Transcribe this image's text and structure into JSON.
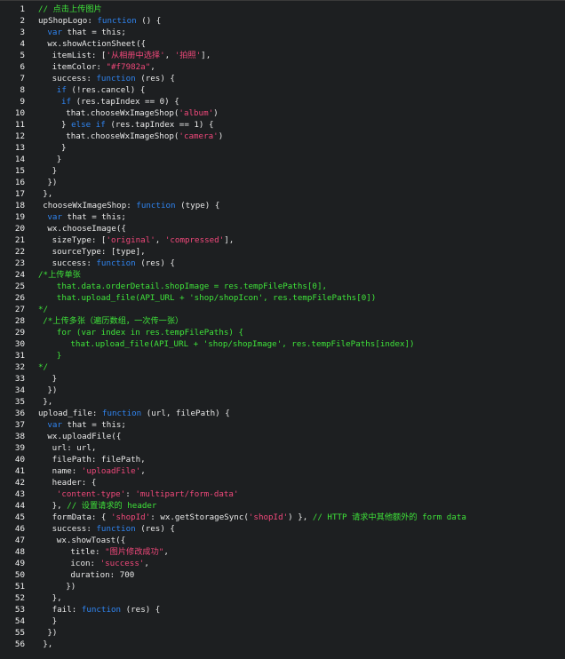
{
  "colors": {
    "background": "#1d1f21",
    "text": "#e8e8e8",
    "keyword": "#2f84f0",
    "string": "#f0487a",
    "comment": "#3fe43a",
    "line_number": "#f2f2f2"
  },
  "lines": [
    {
      "n": "1",
      "indent": 0,
      "tokens": [
        {
          "t": "// 点击上传图片",
          "c": "cm"
        }
      ]
    },
    {
      "n": "2",
      "indent": 0,
      "tokens": [
        {
          "t": "upShopLogo: "
        },
        {
          "t": "function",
          "c": "kw"
        },
        {
          "t": " () {"
        }
      ]
    },
    {
      "n": "3",
      "indent": 2,
      "tokens": [
        {
          "t": "var",
          "c": "kw"
        },
        {
          "t": " that = this;"
        }
      ]
    },
    {
      "n": "4",
      "indent": 2,
      "tokens": [
        {
          "t": "wx.showActionSheet({"
        }
      ]
    },
    {
      "n": "5",
      "indent": 3,
      "tokens": [
        {
          "t": "itemList: ["
        },
        {
          "t": "'从相册中选择'",
          "c": "str"
        },
        {
          "t": ", "
        },
        {
          "t": "'拍照'",
          "c": "str"
        },
        {
          "t": "],"
        }
      ]
    },
    {
      "n": "6",
      "indent": 3,
      "tokens": [
        {
          "t": "itemColor: "
        },
        {
          "t": "\"#f7982a\"",
          "c": "str"
        },
        {
          "t": ","
        }
      ]
    },
    {
      "n": "7",
      "indent": 3,
      "tokens": [
        {
          "t": "success: "
        },
        {
          "t": "function",
          "c": "kw"
        },
        {
          "t": " (res) {"
        }
      ]
    },
    {
      "n": "8",
      "indent": 4,
      "tokens": [
        {
          "t": "if",
          "c": "kw"
        },
        {
          "t": " (!res.cancel) {"
        }
      ]
    },
    {
      "n": "9",
      "indent": 5,
      "tokens": [
        {
          "t": "if",
          "c": "kw"
        },
        {
          "t": " (res.tapIndex == 0) {"
        }
      ]
    },
    {
      "n": "10",
      "indent": 6,
      "tokens": [
        {
          "t": "that.chooseWxImageShop("
        },
        {
          "t": "'album'",
          "c": "str"
        },
        {
          "t": ")"
        }
      ]
    },
    {
      "n": "11",
      "indent": 5,
      "tokens": [
        {
          "t": "} "
        },
        {
          "t": "else if",
          "c": "kw"
        },
        {
          "t": " (res.tapIndex == 1) {"
        }
      ]
    },
    {
      "n": "12",
      "indent": 6,
      "tokens": [
        {
          "t": "that.chooseWxImageShop("
        },
        {
          "t": "'camera'",
          "c": "str"
        },
        {
          "t": ")"
        }
      ]
    },
    {
      "n": "13",
      "indent": 5,
      "tokens": [
        {
          "t": "}"
        }
      ]
    },
    {
      "n": "14",
      "indent": 4,
      "tokens": [
        {
          "t": "}"
        }
      ]
    },
    {
      "n": "15",
      "indent": 3,
      "tokens": [
        {
          "t": "}"
        }
      ]
    },
    {
      "n": "16",
      "indent": 2,
      "tokens": [
        {
          "t": "})"
        }
      ]
    },
    {
      "n": "17",
      "indent": 1,
      "tokens": [
        {
          "t": "},"
        }
      ]
    },
    {
      "n": "18",
      "indent": 1,
      "tokens": [
        {
          "t": "chooseWxImageShop: "
        },
        {
          "t": "function",
          "c": "kw"
        },
        {
          "t": " (type) {"
        }
      ]
    },
    {
      "n": "19",
      "indent": 2,
      "tokens": [
        {
          "t": "var",
          "c": "kw"
        },
        {
          "t": " that = this;"
        }
      ]
    },
    {
      "n": "20",
      "indent": 2,
      "tokens": [
        {
          "t": "wx.chooseImage({"
        }
      ]
    },
    {
      "n": "21",
      "indent": 3,
      "tokens": [
        {
          "t": "sizeType: ["
        },
        {
          "t": "'original'",
          "c": "str"
        },
        {
          "t": ", "
        },
        {
          "t": "'compressed'",
          "c": "str"
        },
        {
          "t": "],"
        }
      ]
    },
    {
      "n": "22",
      "indent": 3,
      "tokens": [
        {
          "t": "sourceType: [type],"
        }
      ]
    },
    {
      "n": "23",
      "indent": 3,
      "tokens": [
        {
          "t": "success: "
        },
        {
          "t": "function",
          "c": "kw"
        },
        {
          "t": " (res) {"
        }
      ]
    },
    {
      "n": "24",
      "indent": 0,
      "tokens": [
        {
          "t": "/*上传单张",
          "c": "cm"
        }
      ]
    },
    {
      "n": "25",
      "indent": 4,
      "tokens": [
        {
          "t": "that.data.orderDetail.shopImage = res.tempFilePaths[0],",
          "c": "cm"
        }
      ]
    },
    {
      "n": "26",
      "indent": 4,
      "tokens": [
        {
          "t": "that.upload_file(API_URL + 'shop/shopIcon', res.tempFilePaths[0])",
          "c": "cm"
        }
      ]
    },
    {
      "n": "27",
      "indent": 0,
      "tokens": [
        {
          "t": "*/",
          "c": "cm"
        }
      ]
    },
    {
      "n": "28",
      "indent": 1,
      "tokens": [
        {
          "t": "/*上传多张（遍历数组，一次传一张）",
          "c": "cm"
        }
      ]
    },
    {
      "n": "29",
      "indent": 4,
      "tokens": [
        {
          "t": "for (var index in res.tempFilePaths) {",
          "c": "cm"
        }
      ]
    },
    {
      "n": "30",
      "indent": 7,
      "tokens": [
        {
          "t": "that.upload_file(API_URL + 'shop/shopImage', res.tempFilePaths[index])",
          "c": "cm"
        }
      ]
    },
    {
      "n": "31",
      "indent": 4,
      "tokens": [
        {
          "t": "}",
          "c": "cm"
        }
      ]
    },
    {
      "n": "32",
      "indent": 0,
      "tokens": [
        {
          "t": "*/",
          "c": "cm"
        }
      ]
    },
    {
      "n": "33",
      "indent": 3,
      "tokens": [
        {
          "t": "}"
        }
      ]
    },
    {
      "n": "34",
      "indent": 2,
      "tokens": [
        {
          "t": "})"
        }
      ]
    },
    {
      "n": "35",
      "indent": 1,
      "tokens": [
        {
          "t": "},"
        }
      ]
    },
    {
      "n": "36",
      "indent": 0,
      "tokens": [
        {
          "t": "upload_file: "
        },
        {
          "t": "function",
          "c": "kw"
        },
        {
          "t": " (url, filePath) {"
        }
      ]
    },
    {
      "n": "37",
      "indent": 2,
      "tokens": [
        {
          "t": "var",
          "c": "kw"
        },
        {
          "t": " that = this;"
        }
      ]
    },
    {
      "n": "38",
      "indent": 2,
      "tokens": [
        {
          "t": "wx.uploadFile({"
        }
      ]
    },
    {
      "n": "39",
      "indent": 3,
      "tokens": [
        {
          "t": "url: url,"
        }
      ]
    },
    {
      "n": "40",
      "indent": 3,
      "tokens": [
        {
          "t": "filePath: filePath,"
        }
      ]
    },
    {
      "n": "41",
      "indent": 3,
      "tokens": [
        {
          "t": "name: "
        },
        {
          "t": "'uploadFile'",
          "c": "str"
        },
        {
          "t": ","
        }
      ]
    },
    {
      "n": "42",
      "indent": 3,
      "tokens": [
        {
          "t": "header: {"
        }
      ]
    },
    {
      "n": "43",
      "indent": 4,
      "tokens": [
        {
          "t": "'content-type'",
          "c": "str"
        },
        {
          "t": ": "
        },
        {
          "t": "'multipart/form-data'",
          "c": "str"
        }
      ]
    },
    {
      "n": "44",
      "indent": 3,
      "tokens": [
        {
          "t": "}, "
        },
        {
          "t": "// 设置请求的 header",
          "c": "cm"
        }
      ]
    },
    {
      "n": "45",
      "indent": 3,
      "tokens": [
        {
          "t": "formData: { "
        },
        {
          "t": "'shopId'",
          "c": "str"
        },
        {
          "t": ": wx.getStorageSync("
        },
        {
          "t": "'shopId'",
          "c": "str"
        },
        {
          "t": ") }, "
        },
        {
          "t": "// HTTP 请求中其他额外的 form data",
          "c": "cm"
        }
      ]
    },
    {
      "n": "46",
      "indent": 3,
      "tokens": [
        {
          "t": "success: "
        },
        {
          "t": "function",
          "c": "kw"
        },
        {
          "t": " (res) {"
        }
      ]
    },
    {
      "n": "47",
      "indent": 4,
      "tokens": [
        {
          "t": "wx.showToast({"
        }
      ]
    },
    {
      "n": "48",
      "indent": 7,
      "tokens": [
        {
          "t": "title: "
        },
        {
          "t": "\"图片修改成功\"",
          "c": "str"
        },
        {
          "t": ","
        }
      ]
    },
    {
      "n": "49",
      "indent": 7,
      "tokens": [
        {
          "t": "icon: "
        },
        {
          "t": "'success'",
          "c": "str"
        },
        {
          "t": ","
        }
      ]
    },
    {
      "n": "50",
      "indent": 7,
      "tokens": [
        {
          "t": "duration: 700"
        }
      ]
    },
    {
      "n": "51",
      "indent": 6,
      "tokens": [
        {
          "t": "})"
        }
      ]
    },
    {
      "n": "52",
      "indent": 3,
      "tokens": [
        {
          "t": "},"
        }
      ]
    },
    {
      "n": "53",
      "indent": 3,
      "tokens": [
        {
          "t": "fail: "
        },
        {
          "t": "function",
          "c": "kw"
        },
        {
          "t": " (res) {"
        }
      ]
    },
    {
      "n": "54",
      "indent": 3,
      "tokens": [
        {
          "t": "}"
        }
      ]
    },
    {
      "n": "55",
      "indent": 2,
      "tokens": [
        {
          "t": "})"
        }
      ]
    },
    {
      "n": "56",
      "indent": 1,
      "tokens": [
        {
          "t": "},"
        }
      ]
    }
  ]
}
